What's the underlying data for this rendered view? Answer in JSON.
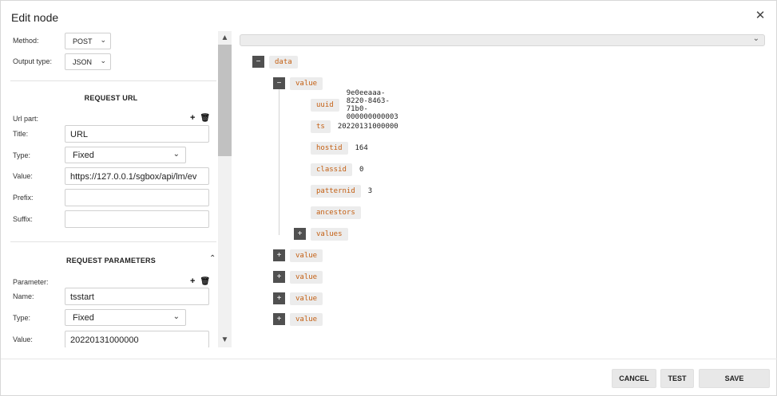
{
  "dialog": {
    "title": "Edit node"
  },
  "form": {
    "method": {
      "label": "Method:",
      "value": "POST"
    },
    "output_type": {
      "label": "Output type:",
      "value": "JSON"
    },
    "request_url": {
      "section_title": "REQUEST URL",
      "part_label": "Url part:",
      "title": {
        "label": "Title:",
        "value": "URL"
      },
      "type": {
        "label": "Type:",
        "value": "Fixed"
      },
      "value": {
        "label": "Value:",
        "value": "https://127.0.0.1/sgbox/api/lm/ev"
      },
      "prefix": {
        "label": "Prefix:",
        "value": ""
      },
      "suffix": {
        "label": "Suffix:",
        "value": ""
      }
    },
    "request_parameters": {
      "section_title": "REQUEST PARAMETERS",
      "parameter_label": "Parameter:",
      "name": {
        "label": "Name:",
        "value": "tsstart"
      },
      "type": {
        "label": "Type:",
        "value": "Fixed"
      },
      "value": {
        "label": "Value:",
        "value": "20220131000000"
      }
    },
    "icons": {
      "add": "+",
      "delete": "🗑",
      "chevron_down": "⌄",
      "chevron_up": "⌃"
    }
  },
  "tree": {
    "root_key": "data",
    "first_item_key": "value",
    "fields": [
      {
        "key": "uuid",
        "value": "9e0eeaaa-8220-8463-71b0-000000000003"
      },
      {
        "key": "ts",
        "value": "20220131000000"
      },
      {
        "key": "hostid",
        "value": "164"
      },
      {
        "key": "classid",
        "value": "0"
      },
      {
        "key": "patternid",
        "value": "3"
      },
      {
        "key": "ancestors",
        "value": ""
      }
    ],
    "values_key": "values",
    "collapsed_items": [
      "value",
      "value",
      "value",
      "value"
    ],
    "toggle_expanded": "−",
    "toggle_collapsed": "+"
  },
  "footer": {
    "cancel": "CANCEL",
    "test": "TEST",
    "save": "SAVE"
  }
}
